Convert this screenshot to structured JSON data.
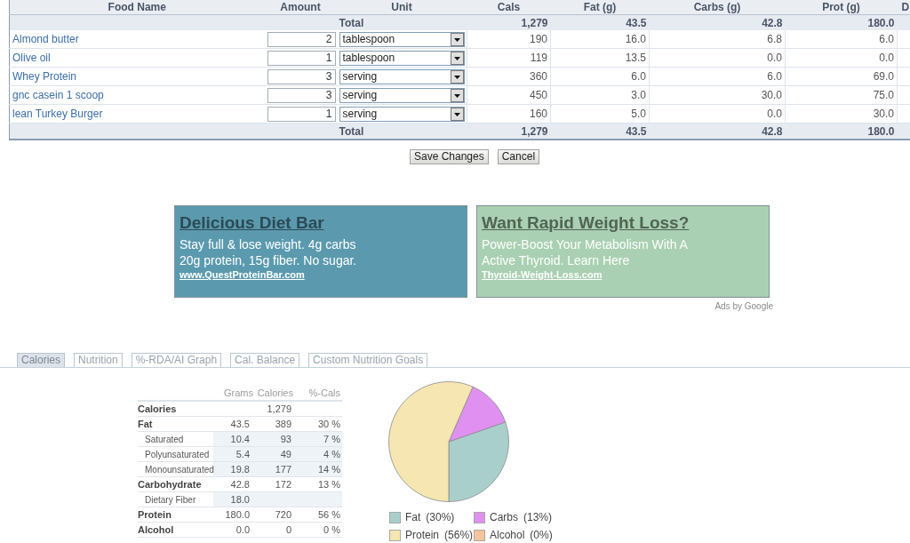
{
  "food_table": {
    "columns": [
      "Food Name",
      "Amount",
      "Unit",
      "Cals",
      "Fat (g)",
      "Carbs (g)",
      "Prot (g)",
      "D"
    ],
    "total_top": {
      "label": "Total",
      "cals": "1,279",
      "fat": "43.5",
      "carbs": "42.8",
      "prot": "180.0"
    },
    "rows": [
      {
        "name": "Almond butter",
        "amount": "2",
        "unit": "tablespoon",
        "cals": "190",
        "fat": "16.0",
        "carbs": "6.8",
        "prot": "6.0"
      },
      {
        "name": "Olive oil",
        "amount": "1",
        "unit": "tablespoon",
        "cals": "119",
        "fat": "13.5",
        "carbs": "0.0",
        "prot": "0.0"
      },
      {
        "name": "Whey Protein",
        "amount": "3",
        "unit": "serving",
        "cals": "360",
        "fat": "6.0",
        "carbs": "6.0",
        "prot": "69.0"
      },
      {
        "name": "gnc casein 1 scoop",
        "amount": "3",
        "unit": "serving",
        "cals": "450",
        "fat": "3.0",
        "carbs": "30.0",
        "prot": "75.0"
      },
      {
        "name": "lean Turkey Burger",
        "amount": "1",
        "unit": "serving",
        "cals": "160",
        "fat": "5.0",
        "carbs": "0.0",
        "prot": "30.0"
      }
    ],
    "total_bottom": {
      "label": "Total",
      "cals": "1,279",
      "fat": "43.5",
      "carbs": "42.8",
      "prot": "180.0"
    }
  },
  "buttons": [
    "Save Changes",
    "Cancel"
  ],
  "ads": [
    {
      "title": "Delicious Diet Bar",
      "lines": [
        "Stay full & lose weight. 4g carbs",
        "20g protein, 15g fiber. No sugar."
      ],
      "url": "www.QuestProteinBar.com",
      "color": "#5b9aae"
    },
    {
      "title": "Want Rapid Weight Loss?",
      "lines": [
        "Power-Boost Your Metabolism With A",
        "Active Thyroid. Learn Here"
      ],
      "url": "Thyroid-Weight-Loss.com",
      "color": "#a9d0b2"
    }
  ],
  "ads_label": "Ads by Google",
  "tabs": [
    {
      "label": "Calories",
      "selected": true
    },
    {
      "label": "Nutrition",
      "selected": false
    },
    {
      "label": "%-RDA/AI Graph",
      "selected": false
    },
    {
      "label": "Cal. Balance",
      "selected": false
    },
    {
      "label": "Custom Nutrition Goals",
      "selected": false
    }
  ],
  "nutrition_table": {
    "columns": [
      "Grams",
      "Calories",
      "%-Cals"
    ],
    "rows": [
      {
        "label": "Calories",
        "calories": "1,279"
      },
      {
        "label": "Fat",
        "grams": "43.5",
        "calories": "389",
        "percent": "30 %",
        "children": [
          {
            "label": "Saturated",
            "grams": "10.4",
            "calories": "93",
            "percent": "7 %"
          },
          {
            "label": "Polyunsaturated",
            "grams": "5.4",
            "calories": "49",
            "percent": "4 %"
          },
          {
            "label": "Monounsaturated",
            "grams": "19.8",
            "calories": "177",
            "percent": "14 %"
          }
        ]
      },
      {
        "label": "Carbohydrate",
        "grams": "42.8",
        "calories": "172",
        "percent": "13 %",
        "children": [
          {
            "label": "Dietary Fiber",
            "grams": "18.0"
          }
        ]
      },
      {
        "label": "Protein",
        "grams": "180.0",
        "calories": "720",
        "percent": "56 %"
      },
      {
        "label": "Alcohol",
        "grams": "0.0",
        "calories": "0",
        "percent": "0 %"
      }
    ]
  },
  "pie": {
    "chart_data": {
      "type": "pie",
      "categories": [
        "Fat",
        "Carbs",
        "Protein",
        "Alcohol"
      ],
      "values": [
        30,
        13,
        56,
        0
      ]
    },
    "legend": [
      {
        "share": "(30%)",
        "color": "#a9cfcc"
      },
      {
        "share": "(13%)",
        "color": "#df90f0"
      },
      {
        "share": "(56%)",
        "color": "#f5e6b2"
      },
      {
        "share": "(0%)",
        "color": "#f5c49c"
      }
    ]
  }
}
